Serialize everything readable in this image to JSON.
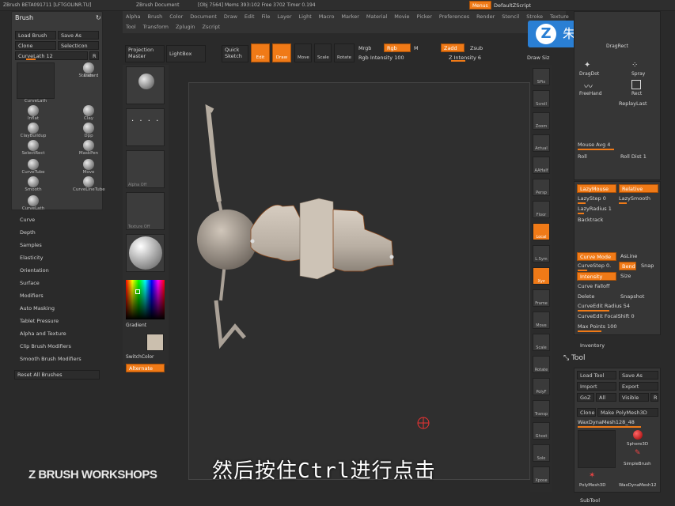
{
  "title_bar": {
    "app": "ZBrush BETA091711 [LFTGOLINR.TU]",
    "doc": "ZBrush Document",
    "stats": "[Obj 7564] Mems 393:102 Free 3702 Timer 0.194",
    "menus_btn": "Menus",
    "default_script": "DefaultZScript"
  },
  "menu_items": [
    "Alpha",
    "Brush",
    "Color",
    "Document",
    "Draw",
    "Edit",
    "File",
    "Layer",
    "Light",
    "Macro",
    "Marker",
    "Material",
    "Movie",
    "Picker",
    "Preferences",
    "Render",
    "Stencil",
    "Stroke",
    "Texture"
  ],
  "menu_items_row2": [
    "Tool",
    "Transform",
    "Zplugin",
    "Zscript"
  ],
  "toolbar": {
    "projection_master": "Projection Master",
    "lightbox": "LightBox",
    "quick_sketch": "Quick Sketch",
    "edit": "Edit",
    "draw": "Draw",
    "move": "Move",
    "scale": "Scale",
    "rotate": "Rotate",
    "mrgb": "Mrgb",
    "rgb": "Rgb",
    "m": "M",
    "zadd": "Zadd",
    "zsub": "Zsub",
    "rgb_intensity": "Rgb Intensity 100",
    "z_intensity": "Z Intensity 6",
    "draw_size": "Draw Siz"
  },
  "brush_panel": {
    "title": "Brush",
    "load_brush": "Load Brush",
    "save_as": "Save As",
    "clone": "Clone",
    "select_icon": "SelectIcon",
    "current": "CurveLath 12",
    "r": "R",
    "brushes": [
      "CurveLath",
      "Standard",
      "Dam",
      "Inflat",
      "Clay",
      "ClayBuildup",
      "Dpp",
      "SelectRect",
      "MaskPen",
      "CurveTube",
      "Move",
      "Smooth",
      "CurveLineTube",
      "CurveLath"
    ]
  },
  "brush_list": [
    "Curve",
    "Depth",
    "Samples",
    "Elasticity",
    "Orientation",
    "Surface",
    "Modifiers",
    "Auto Masking",
    "Tablet Pressure",
    "Alpha and Texture",
    "Clip Brush Modifiers",
    "Smooth Brush Modifiers"
  ],
  "reset_all": "Reset All Brushes",
  "shelf": {
    "alpha_off": "Alpha Off",
    "texture_off": "Texture Off",
    "material": "MatCap",
    "gradient": "Gradient",
    "switch_color": "SwitchColor",
    "alternate": "Alternate"
  },
  "right_icons": [
    "SPix",
    "Scroll",
    "Zoom",
    "Actual",
    "AAHalf",
    "Persp",
    "Floor",
    "Local",
    "L.Sym",
    "Xyz",
    "Frame",
    "Move",
    "Scale",
    "Rotate",
    "PolyF",
    "Transp",
    "Ghost",
    "Solo",
    "Xpose"
  ],
  "right_panel": {
    "dragrect": "DragRect",
    "dragdot": "DragDot",
    "spray": "Spray",
    "freehand": "FreeHand",
    "rect": "Rect",
    "replay_last": "ReplayLast",
    "mouse_avg": "Mouse Avg 4",
    "roll": "Roll",
    "roll_dist": "Roll Dist 1",
    "lazy_mouse": "LazyMouse",
    "relative": "Relative",
    "lazy_step": "LazyStep 0",
    "lazy_smooth": "LazySmooth",
    "lazy_radius": "LazyRadius 1",
    "backtrack": "Backtrack",
    "curve_mode": "Curve Mode",
    "asline": "AsLine",
    "curve_step": "CurveStep 0.",
    "bend": "Bend",
    "snap": "Snap",
    "intensity": "Intensity",
    "size": "Size",
    "curve_falloff": "Curve Falloff",
    "delete": "Delete",
    "snapshot": "Snapshot",
    "curve_edit_radius": "CurveEdit Radius 54",
    "curve_edit_focal": "CurveEdit FocalShift 0",
    "max_points": "Max Points 100",
    "inventory": "Inventory",
    "tool": "Tool",
    "load_tool": "Load Tool",
    "save_as": "Save As",
    "import": "Import",
    "export": "Export",
    "goz": "GoZ",
    "all": "All",
    "visible": "Visible",
    "r": "R",
    "clone": "Clone",
    "make_polymesh": "Make PolyMesh3D",
    "waxdyna": "WaxDynaMesh128_48",
    "sphere3d": "Sphere3D",
    "simplebrush": "SimpleBrush",
    "polymesh3d": "PolyMesh3D",
    "waxdyna2": "WaxDynaMesh12",
    "subtool": "SubTool"
  },
  "subtitle": "然后按住Ctrl进行点击",
  "watermark": "Z BRUSH WORKSHOPS",
  "logo_text": "朱峰社区",
  "colors": {
    "accent": "#f07a17",
    "bg": "#2a2a2a",
    "logo": "#2a7fd4"
  }
}
